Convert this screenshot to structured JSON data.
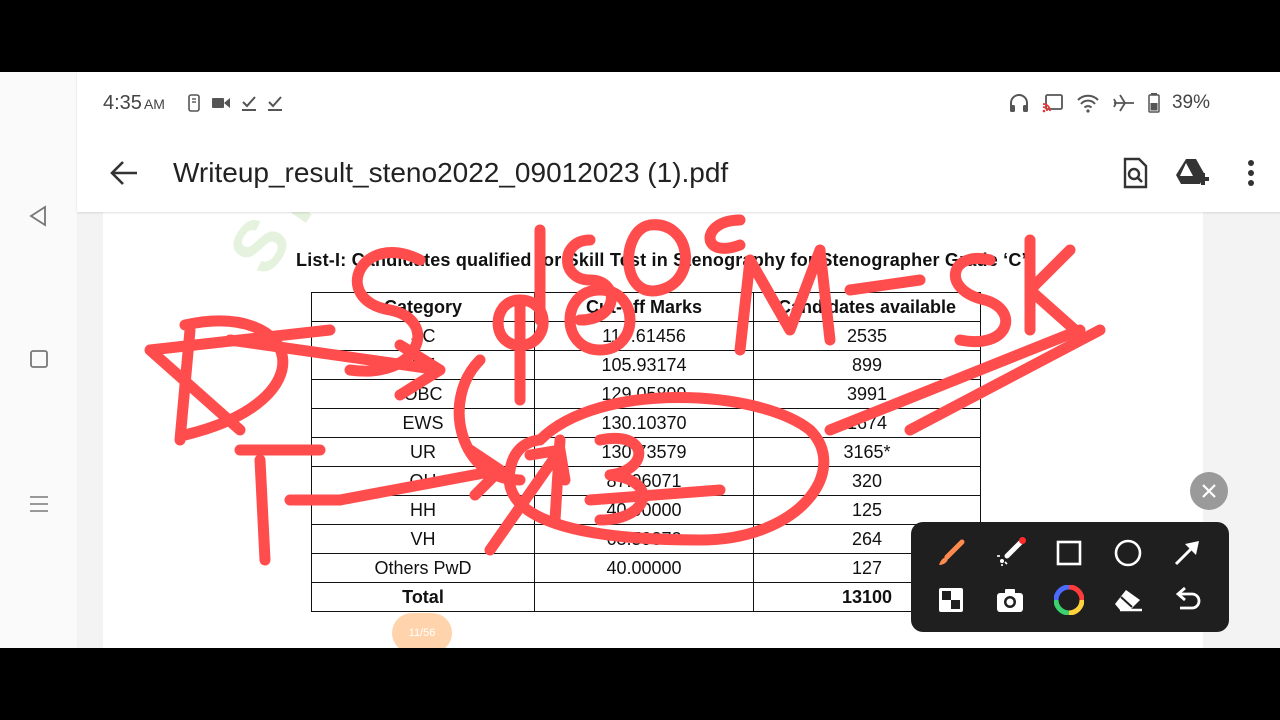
{
  "status_bar": {
    "time": "4:35",
    "ampm": "AM",
    "battery": "39%"
  },
  "app_bar": {
    "title": "Writeup_result_steno2022_09012023 (1).pdf"
  },
  "document": {
    "heading": "List-I: Candidates qualified for Skill Test in Stenography for Stenographer Grade ‘C’:",
    "watermark": "STAFFSELECTION",
    "columns": [
      "Category",
      "Cut-off Marks",
      "Candidates available"
    ],
    "rows": [
      [
        "SC",
        "114.61456",
        "2535"
      ],
      [
        "ST",
        "105.93174",
        "899"
      ],
      [
        "OBC",
        "129.05899",
        "3991"
      ],
      [
        "EWS",
        "130.10370",
        "1674"
      ],
      [
        "UR",
        "130.73579",
        "3165*"
      ],
      [
        "OH",
        "87.96071",
        "320"
      ],
      [
        "HH",
        "40.00000",
        "125"
      ],
      [
        "VH",
        "63.59872",
        "264"
      ],
      [
        "Others PwD",
        "40.00000",
        "127"
      ]
    ],
    "total": {
      "label": "Total",
      "value": "13100"
    },
    "page_indicator": "11/56"
  },
  "colors": {
    "ink": "#ff4d4d",
    "toolbar_bg": "#1f1f1f",
    "accent_red": "#ff2a2a"
  },
  "annotation_toolbar": {
    "tools": [
      "pen-tool",
      "laser-pointer-tool",
      "rectangle-tool",
      "circle-tool",
      "arrow-tool",
      "whiteboard-tool",
      "screenshot-tool",
      "color-picker-tool",
      "eraser-tool",
      "undo-tool"
    ]
  }
}
